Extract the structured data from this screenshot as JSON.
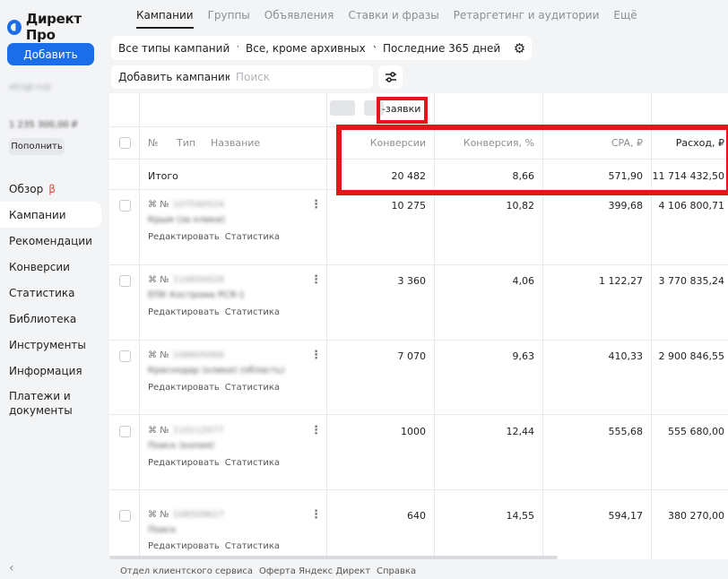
{
  "app": {
    "logo_text": "Директ Про"
  },
  "sidebar": {
    "add_label": "Добавить",
    "login": "elcigt-rus",
    "balance": "1 235 300,00 ₽",
    "topup_label": "Пополнить",
    "beta_mark": "β",
    "collapse_glyph": "‹",
    "items": [
      {
        "label": "Обзор"
      },
      {
        "label": "Кампании"
      },
      {
        "label": "Рекомендации"
      },
      {
        "label": "Конверсии"
      },
      {
        "label": "Статистика"
      },
      {
        "label": "Библиотека"
      },
      {
        "label": "Инструменты"
      },
      {
        "label": "Информация"
      },
      {
        "label": "Платежи и документы"
      }
    ]
  },
  "tabs": [
    "Кампании",
    "Группы",
    "Объявления",
    "Ставки и фразы",
    "Ретаргетинг и аудитории",
    "Ещё"
  ],
  "filters": {
    "type": "Все типы кампаний",
    "status": "Все, кроме архивных",
    "period": "Последние 365 дней",
    "add_campaign": "Добавить кампанию",
    "search_placeholder": "Поиск"
  },
  "table": {
    "goal_label": "-заявки",
    "headers": {
      "num": "№",
      "type": "Тип",
      "name": "Название",
      "conversions": "Конверсии",
      "conv_rate": "Конверсия, %",
      "cpa": "CPA, ₽",
      "spend": "Расход, ₽"
    },
    "total": {
      "label": "Итого",
      "conversions": "20 482",
      "conv_rate": "8,66",
      "cpa": "571,90",
      "spend": "11 714 432,50"
    },
    "row_actions": {
      "edit": "Редактировать",
      "stats": "Статистика",
      "id_prefix": "№"
    },
    "rows": [
      {
        "id": "107540524",
        "name": "Крым (за клики)",
        "conversions": "10 275",
        "conv_rate": "10,82",
        "cpa": "399,68",
        "spend": "4 106 800,71"
      },
      {
        "id": "110650029",
        "name": "ЕПК Кострома РСЯ-1",
        "conversions": "3 360",
        "conv_rate": "4,06",
        "cpa": "1 122,27",
        "spend": "3 770 835,24"
      },
      {
        "id": "108605066",
        "name": "Краснодар (клики) (область)",
        "conversions": "7 070",
        "conv_rate": "9,63",
        "cpa": "410,33",
        "spend": "2 900 846,55"
      },
      {
        "id": "110112077",
        "name": "Поиск (копия)",
        "conversions": "1000",
        "conv_rate": "12,44",
        "cpa": "555,68",
        "spend": "555 680,00"
      },
      {
        "id": "108509627",
        "name": "Поиск",
        "conversions": "640",
        "conv_rate": "14,55",
        "cpa": "594,17",
        "spend": "380 270,00"
      }
    ]
  },
  "footer": [
    "Отдел клиентского сервиса",
    "Оферта Яндекс Директ",
    "Справка"
  ],
  "colors": {
    "accent": "#1b6ee8",
    "highlight": "#e3161a",
    "beta": "#e5483d"
  }
}
